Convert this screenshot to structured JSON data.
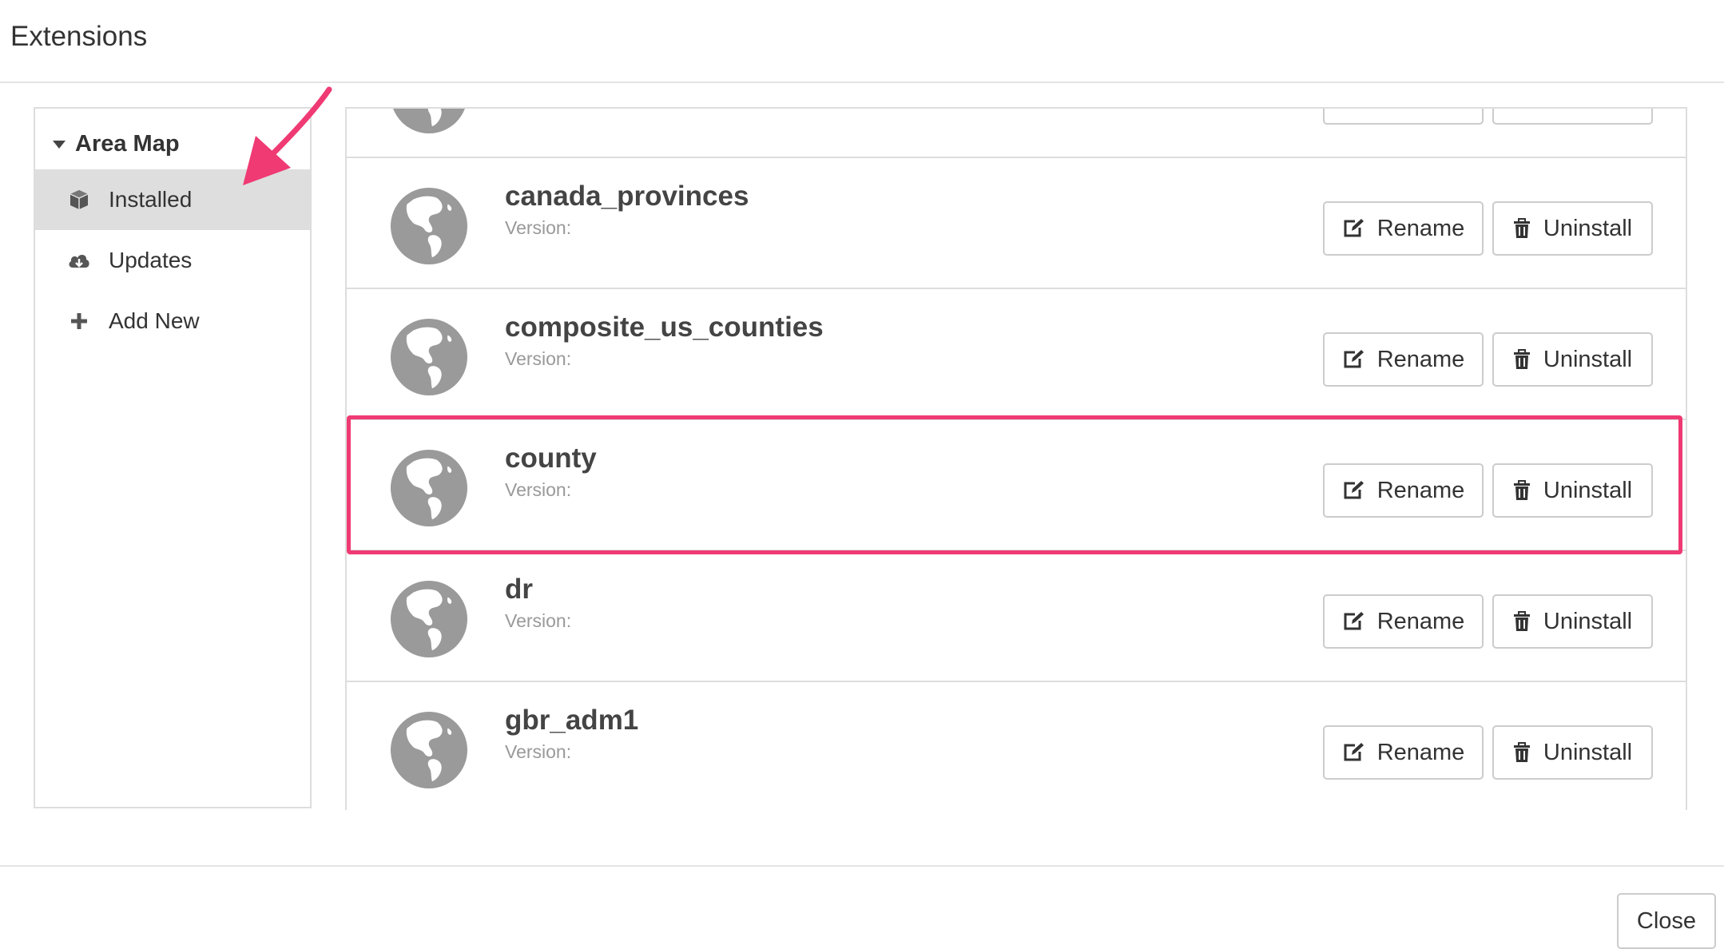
{
  "dialog": {
    "title": "Extensions",
    "close_label": "Close"
  },
  "sidebar": {
    "group_label": "Area Map",
    "items": [
      {
        "label": "Installed",
        "icon": "box-icon",
        "active": true
      },
      {
        "label": "Updates",
        "icon": "cloud-download-icon",
        "active": false
      },
      {
        "label": "Add New",
        "icon": "plus-icon",
        "active": false
      }
    ]
  },
  "extensions": [
    {
      "name": "",
      "version_label": "",
      "partial": true
    },
    {
      "name": "canada_provinces",
      "version_label": "Version:"
    },
    {
      "name": "composite_us_counties",
      "version_label": "Version:"
    },
    {
      "name": "county",
      "version_label": "Version:",
      "highlighted": true
    },
    {
      "name": "dr",
      "version_label": "Version:"
    },
    {
      "name": "gbr_adm1",
      "version_label": "Version:"
    }
  ],
  "buttons": {
    "rename_label": "Rename",
    "uninstall_label": "Uninstall"
  },
  "colors": {
    "highlight": "#ef3a73",
    "active_item_bg": "#dedede",
    "globe": "#9a9a9a"
  }
}
